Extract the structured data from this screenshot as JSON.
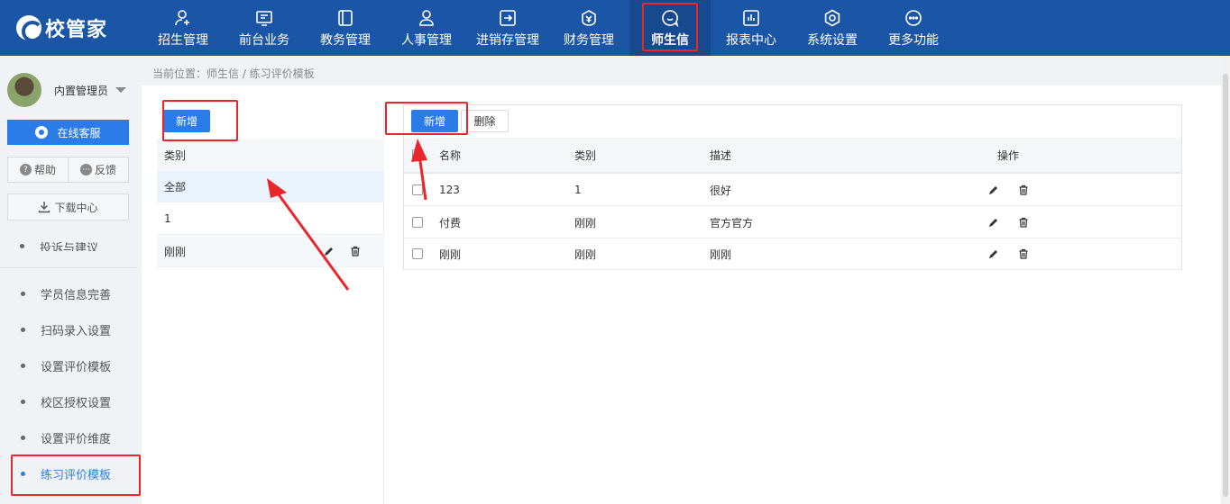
{
  "app": {
    "logo_text": "校管家"
  },
  "nav": [
    {
      "label": "招生管理",
      "icon": "person-add-icon"
    },
    {
      "label": "前台业务",
      "icon": "monitor-icon"
    },
    {
      "label": "教务管理",
      "icon": "book-icon"
    },
    {
      "label": "人事管理",
      "icon": "person-icon"
    },
    {
      "label": "进销存管理",
      "icon": "inventory-icon"
    },
    {
      "label": "财务管理",
      "icon": "finance-icon"
    },
    {
      "label": "师生信",
      "icon": "chat-icon",
      "active": true
    },
    {
      "label": "报表中心",
      "icon": "report-icon"
    },
    {
      "label": "系统设置",
      "icon": "settings-icon"
    },
    {
      "label": "更多功能",
      "icon": "more-icon"
    }
  ],
  "sidebar": {
    "user_name": "内置管理员",
    "online_service": "在线客服",
    "help": "帮助",
    "feedback": "反馈",
    "download": "下载中心",
    "cut_item": "投诉与建议",
    "menu": [
      {
        "label": "学员信息完善"
      },
      {
        "label": "扫码录入设置"
      },
      {
        "label": "设置评价模板"
      },
      {
        "label": "校区授权设置"
      },
      {
        "label": "设置评价维度"
      },
      {
        "label": "练习评价模板",
        "active": true
      }
    ]
  },
  "breadcrumb": "当前位置：师生信 / 练习评价模板",
  "category_panel": {
    "add_label": "新增",
    "header": "类别",
    "rows": [
      {
        "label": "全部"
      },
      {
        "label": "1"
      },
      {
        "label": "刚刚"
      }
    ]
  },
  "template_panel": {
    "add_label": "新增",
    "delete_label": "删除",
    "columns": {
      "name": "名称",
      "category": "类别",
      "description": "描述",
      "actions": "操作"
    },
    "rows": [
      {
        "name": "123",
        "category": "1",
        "description": "很好"
      },
      {
        "name": "付费",
        "category": "刚刚",
        "description": "官方官方"
      },
      {
        "name": "刚刚",
        "category": "刚刚",
        "description": "刚刚"
      }
    ]
  },
  "colors": {
    "nav_bg": "#1b56a6",
    "accent": "#2b7ce9",
    "highlight": "#e8262b"
  }
}
